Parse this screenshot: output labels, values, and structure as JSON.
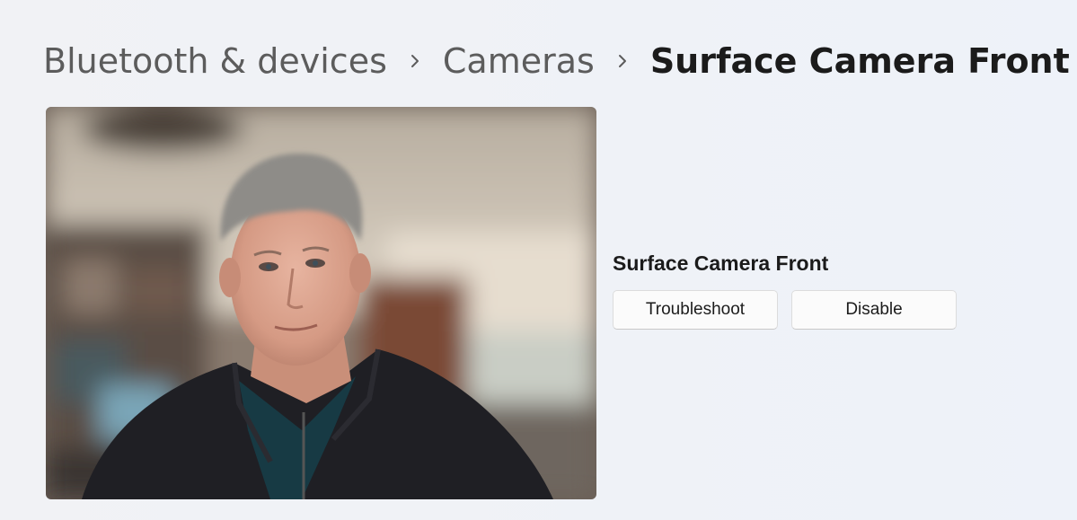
{
  "breadcrumb": {
    "items": [
      {
        "label": "Bluetooth & devices"
      },
      {
        "label": "Cameras"
      },
      {
        "label": "Surface Camera Front"
      }
    ]
  },
  "camera": {
    "name": "Surface Camera Front",
    "actions": {
      "troubleshoot_label": "Troubleshoot",
      "disable_label": "Disable"
    }
  },
  "colors": {
    "background": "#eff2f7",
    "breadcrumb_text": "#5c5c5c",
    "current_text": "#1b1b1b",
    "button_bg": "#fbfbfb",
    "button_border": "#dcdcdc"
  },
  "icons": {
    "breadcrumb_separator": "chevron-right-icon"
  }
}
